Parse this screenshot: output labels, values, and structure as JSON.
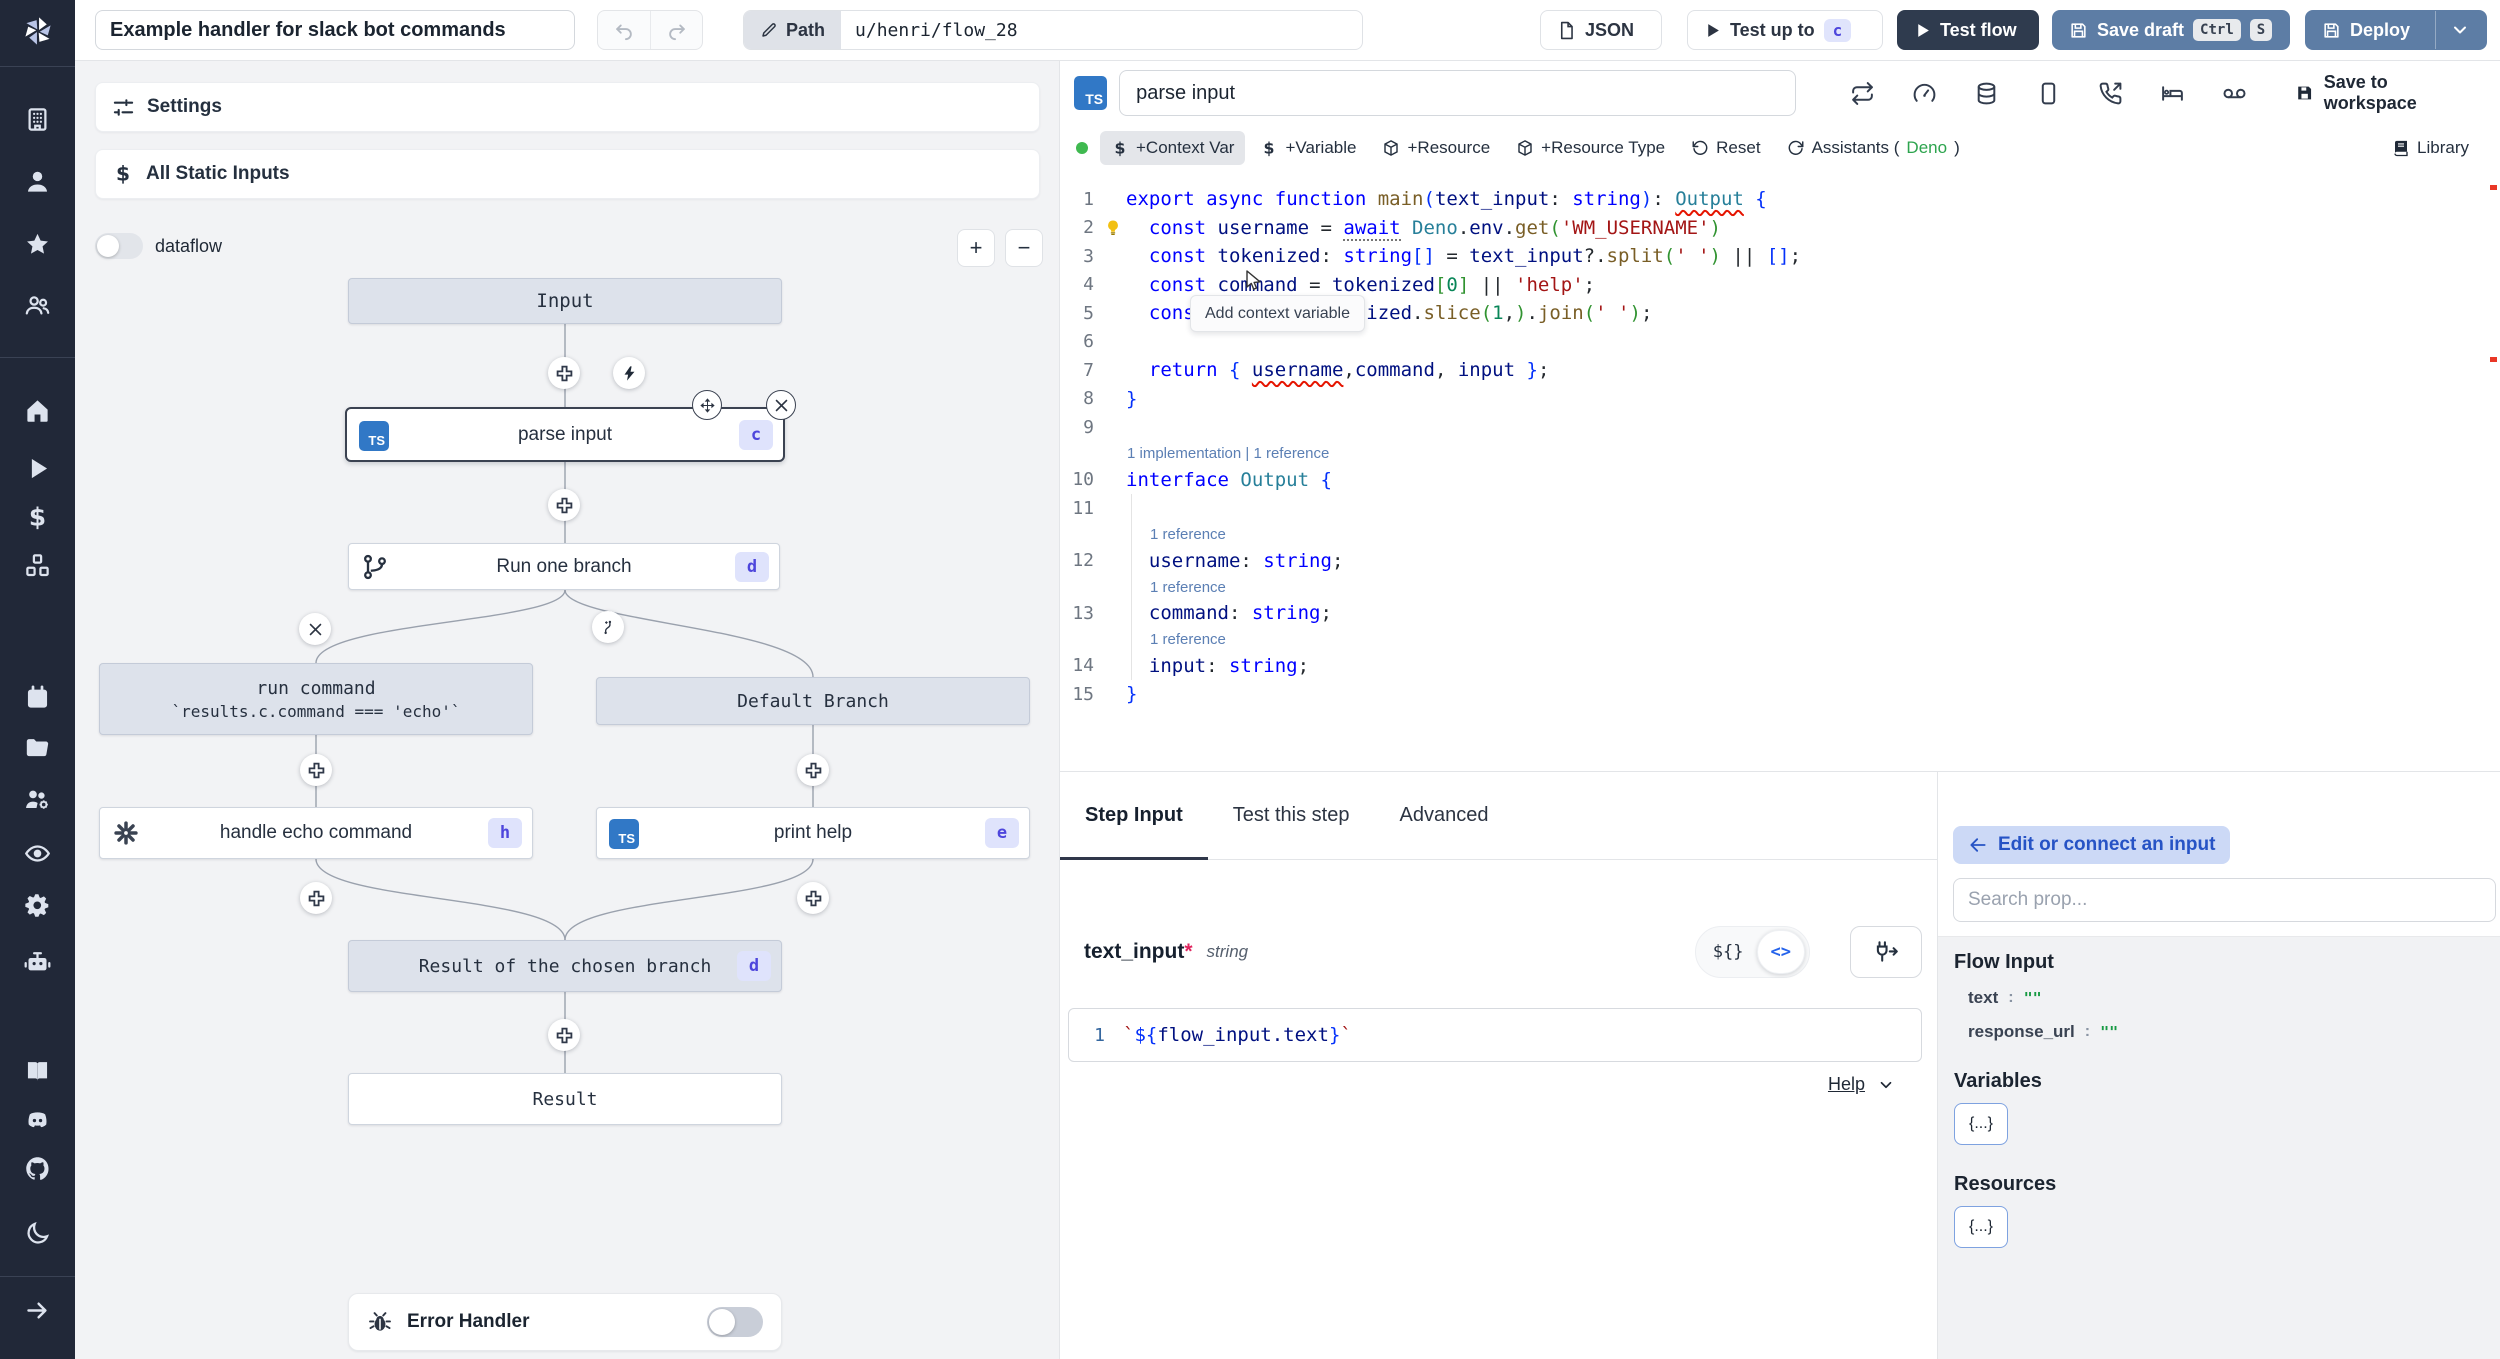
{
  "topbar": {
    "title": "Example handler for slack bot commands",
    "path_label": "Path",
    "path_value": "u/henri/flow_28",
    "json_label": "JSON",
    "test_up_to": "Test up to",
    "test_up_to_badge": "c",
    "test_flow": "Test flow",
    "save_draft": "Save draft",
    "kbd_ctrl": "Ctrl",
    "kbd_s": "S",
    "deploy": "Deploy"
  },
  "sidebar": {
    "icons": [
      "windmill-logo",
      "building-icon",
      "user-icon",
      "star-icon",
      "users-icon",
      "home-icon",
      "play-icon",
      "dollar-icon",
      "boxes-icon",
      "calendar-icon",
      "folder-icon",
      "users-gear-icon",
      "eye-icon",
      "gear-icon",
      "robot-icon",
      "book-icon",
      "discord-icon",
      "github-icon",
      "moon-icon",
      "arrow-right-icon"
    ]
  },
  "flow_panel": {
    "settings": "Settings",
    "all_static_inputs": "All Static Inputs",
    "dataflow": "dataflow",
    "zoom_in": "+",
    "zoom_out": "−",
    "nodes": {
      "input": "Input",
      "parse": "parse input",
      "parse_badge": "c",
      "parse_lang": "TS",
      "run_one": "Run one branch",
      "run_one_badge": "d",
      "run_cmd_line1": "run command",
      "run_cmd_line2": "`results.c.command === 'echo'`",
      "default_branch": "Default Branch",
      "echo": "handle echo command",
      "echo_badge": "h",
      "print": "print help",
      "print_badge": "e",
      "print_lang": "TS",
      "result_chosen": "Result of the chosen branch",
      "result_chosen_badge": "d",
      "result": "Result"
    },
    "error_handler": "Error Handler"
  },
  "editor": {
    "lang_badge": "TS",
    "step_name": "parse input",
    "header_icons": [
      "repeat-icon",
      "gauge-icon",
      "database-icon",
      "smartphone-icon",
      "phone-incoming-icon",
      "bed-icon",
      "voicemail-icon"
    ],
    "save_to_workspace": "Save to workspace",
    "toolbar": {
      "context_var": "+Context Var",
      "variable": "+Variable",
      "resource": "+Resource",
      "resource_type": "+Resource Type",
      "reset": "Reset",
      "assistants_prefix": "Assistants (",
      "assistants_runtime": "Deno",
      "assistants_suffix": ")",
      "library": "Library"
    },
    "tooltip": "Add context variable",
    "code_rows": [
      {
        "t": "code",
        "n": "1",
        "tok": [
          [
            "kw",
            "export"
          ],
          [
            "pl",
            " "
          ],
          [
            "kw",
            "async"
          ],
          [
            "pl",
            " "
          ],
          [
            "kw",
            "function"
          ],
          [
            "pl",
            " "
          ],
          [
            "fn",
            "main"
          ],
          [
            "brb",
            "("
          ],
          [
            "var",
            "text_input"
          ],
          [
            "pl",
            ": "
          ],
          [
            "kw",
            "string"
          ],
          [
            "brb",
            ")"
          ],
          [
            "pl",
            ": "
          ],
          [
            "type err",
            "Output"
          ],
          [
            "pl",
            " "
          ],
          [
            "brb",
            "{"
          ]
        ]
      },
      {
        "t": "code",
        "n": "2",
        "bulb": true,
        "tok": [
          [
            "pl",
            "  "
          ],
          [
            "kw",
            "const"
          ],
          [
            "pl",
            " "
          ],
          [
            "var",
            "username"
          ],
          [
            "pl",
            " = "
          ],
          [
            "kw hint",
            "await"
          ],
          [
            "pl",
            " "
          ],
          [
            "type",
            "Deno"
          ],
          [
            "pl",
            "."
          ],
          [
            "var",
            "env"
          ],
          [
            "pl",
            "."
          ],
          [
            "fn",
            "get"
          ],
          [
            "brg",
            "("
          ],
          [
            "str",
            "'WM_USERNAME'"
          ],
          [
            "brg",
            ")"
          ]
        ]
      },
      {
        "t": "code",
        "n": "3",
        "tok": [
          [
            "pl",
            "  "
          ],
          [
            "kw",
            "const"
          ],
          [
            "pl",
            " "
          ],
          [
            "var",
            "tokenized"
          ],
          [
            "pl",
            ": "
          ],
          [
            "kw",
            "string"
          ],
          [
            "brb",
            "[]"
          ],
          [
            "pl",
            " = "
          ],
          [
            "var",
            "text_input"
          ],
          [
            "pl",
            "?."
          ],
          [
            "fn",
            "split"
          ],
          [
            "brg",
            "("
          ],
          [
            "str",
            "' '"
          ],
          [
            "brg",
            ")"
          ],
          [
            "pl",
            " || "
          ],
          [
            "brb",
            "[]"
          ],
          [
            "pl",
            ";"
          ]
        ]
      },
      {
        "t": "code",
        "n": "4",
        "tok": [
          [
            "pl",
            "  "
          ],
          [
            "kw",
            "const"
          ],
          [
            "pl",
            " "
          ],
          [
            "var",
            "command"
          ],
          [
            "pl",
            " = "
          ],
          [
            "var",
            "tokenized"
          ],
          [
            "brg",
            "["
          ],
          [
            "num",
            "0"
          ],
          [
            "brg",
            "]"
          ],
          [
            "pl",
            " || "
          ],
          [
            "str",
            "'help'"
          ],
          [
            "pl",
            ";"
          ]
        ]
      },
      {
        "t": "code",
        "n": "5",
        "tok": [
          [
            "pl",
            "  "
          ],
          [
            "kw",
            "const"
          ],
          [
            "pl",
            " "
          ],
          [
            "var",
            "input"
          ],
          [
            "pl",
            " = "
          ],
          [
            "var",
            "tokenized"
          ],
          [
            "pl",
            "."
          ],
          [
            "fn",
            "slice"
          ],
          [
            "brg",
            "("
          ],
          [
            "num",
            "1"
          ],
          [
            "pl",
            ","
          ],
          [
            "brg",
            ")"
          ],
          [
            "pl",
            "."
          ],
          [
            "fn",
            "join"
          ],
          [
            "brg",
            "("
          ],
          [
            "str",
            "' '"
          ],
          [
            "brg",
            ")"
          ],
          [
            "pl",
            ";"
          ]
        ]
      },
      {
        "t": "code",
        "n": "6",
        "tok": []
      },
      {
        "t": "code",
        "n": "7",
        "tok": [
          [
            "pl",
            "  "
          ],
          [
            "kw",
            "return"
          ],
          [
            "pl",
            " "
          ],
          [
            "brb",
            "{"
          ],
          [
            "pl",
            " "
          ],
          [
            "var err",
            "username"
          ],
          [
            "pl",
            ","
          ],
          [
            "var",
            "command"
          ],
          [
            "pl",
            ", "
          ],
          [
            "var",
            "input"
          ],
          [
            "pl",
            " "
          ],
          [
            "brb",
            "}"
          ],
          [
            "pl",
            ";"
          ]
        ]
      },
      {
        "t": "code",
        "n": "8",
        "tok": [
          [
            "brb",
            "}"
          ]
        ]
      },
      {
        "t": "code",
        "n": "9",
        "tok": []
      },
      {
        "t": "lens",
        "text": "1 implementation | 1 reference",
        "indent": 0
      },
      {
        "t": "code",
        "n": "10",
        "tok": [
          [
            "kw",
            "interface"
          ],
          [
            "pl",
            " "
          ],
          [
            "type",
            "Output"
          ],
          [
            "pl",
            " "
          ],
          [
            "brb",
            "{"
          ]
        ]
      },
      {
        "t": "code",
        "n": "11",
        "guide": true,
        "tok": []
      },
      {
        "t": "lens",
        "text": "1 reference",
        "indent": 1,
        "guide": true
      },
      {
        "t": "code",
        "n": "12",
        "guide": true,
        "tok": [
          [
            "pl",
            "  "
          ],
          [
            "var",
            "username"
          ],
          [
            "pl",
            ": "
          ],
          [
            "kw",
            "string"
          ],
          [
            "pl",
            ";"
          ]
        ]
      },
      {
        "t": "lens",
        "text": "1 reference",
        "indent": 1,
        "guide": true
      },
      {
        "t": "code",
        "n": "13",
        "guide": true,
        "tok": [
          [
            "pl",
            "  "
          ],
          [
            "var",
            "command"
          ],
          [
            "pl",
            ": "
          ],
          [
            "kw",
            "string"
          ],
          [
            "pl",
            ";"
          ]
        ]
      },
      {
        "t": "lens",
        "text": "1 reference",
        "indent": 1,
        "guide": true
      },
      {
        "t": "code",
        "n": "14",
        "guide": true,
        "tok": [
          [
            "pl",
            "  "
          ],
          [
            "var",
            "input"
          ],
          [
            "pl",
            ": "
          ],
          [
            "kw",
            "string"
          ],
          [
            "pl",
            ";"
          ]
        ]
      },
      {
        "t": "code",
        "n": "15",
        "tok": [
          [
            "brb",
            "}"
          ]
        ]
      }
    ]
  },
  "step_panel": {
    "tabs": [
      "Step Input",
      "Test this step",
      "Advanced"
    ],
    "active_tab": "Step Input",
    "field_name": "text_input",
    "field_required": "*",
    "field_type": "string",
    "toggle_expr": "${}",
    "toggle_code": "<>",
    "editor_line_no": "1",
    "editor_tokens": [
      [
        "str",
        "`"
      ],
      [
        "brb",
        "${"
      ],
      [
        "var",
        "flow_input.text"
      ],
      [
        "brb",
        "}"
      ],
      [
        "str",
        "`"
      ]
    ],
    "help": "Help"
  },
  "prop_picker": {
    "edit_connect": "Edit or connect an input",
    "search_placeholder": "Search prop...",
    "sections": [
      {
        "title": "Flow Input",
        "rows": [
          {
            "key": "text",
            "value": "\"\""
          },
          {
            "key": "response_url",
            "value": "\"\""
          }
        ]
      },
      {
        "title": "Variables",
        "button": "{...}"
      },
      {
        "title": "Resources",
        "button": "{...}"
      }
    ]
  },
  "colors": {
    "sidebar_bg": "#212838",
    "primary_button_blue": "#5d7da5",
    "dark_button": "#2f3b4e",
    "badge_indigo_bg": "#dfe3fc",
    "badge_indigo_text": "#4e46dc",
    "ts_badge_blue": "#3178c6",
    "deno_green": "#2da44e",
    "toolbar_ready_dot": "#3fb950",
    "error_red": "#e51400"
  }
}
